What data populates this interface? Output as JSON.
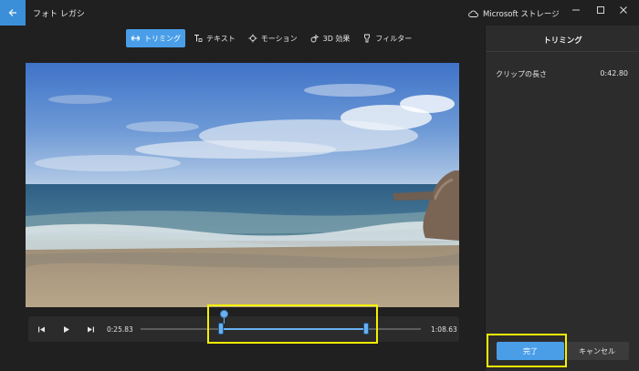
{
  "app": {
    "title": "フォト レガシ",
    "storage_label": "Microsoft ストレージ"
  },
  "toolbar": {
    "items": [
      {
        "label": "トリミング",
        "icon": "trim-icon",
        "active": true
      },
      {
        "label": "テキスト",
        "icon": "text-icon",
        "active": false
      },
      {
        "label": "モーション",
        "icon": "motion-icon",
        "active": false
      },
      {
        "label": "3D 効果",
        "icon": "3d-effects-icon",
        "active": false
      },
      {
        "label": "フィルター",
        "icon": "filter-icon",
        "active": false
      }
    ]
  },
  "playback": {
    "current_time": "0:25.83",
    "end_time": "1:08.63"
  },
  "panel": {
    "title": "トリミング",
    "clip_length_label": "クリップの長さ",
    "clip_length_value": "0:42.80",
    "done_label": "完了",
    "cancel_label": "キャンセル"
  },
  "colors": {
    "accent": "#4a9ee8",
    "highlight": "#f5f100",
    "background": "#202020",
    "panel": "#2c2c2c"
  }
}
